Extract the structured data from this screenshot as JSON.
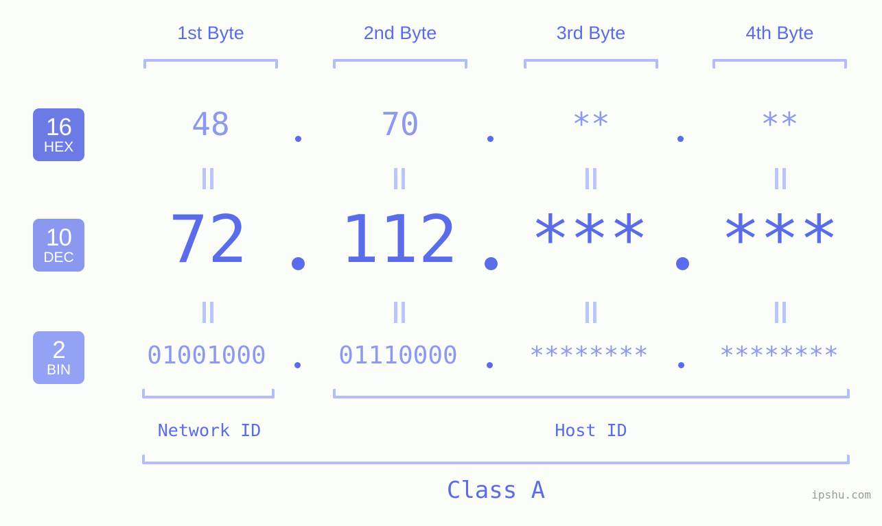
{
  "watermark": "ipshu.com",
  "columns": [
    {
      "label": "1st Byte"
    },
    {
      "label": "2nd Byte"
    },
    {
      "label": "3rd Byte"
    },
    {
      "label": "4th Byte"
    }
  ],
  "bases": [
    {
      "num": "16",
      "abbr": "HEX",
      "color": "#6c7ae6"
    },
    {
      "num": "10",
      "abbr": "DEC",
      "color": "#8b98ef"
    },
    {
      "num": "2",
      "abbr": "BIN",
      "color": "#93a2f5"
    }
  ],
  "rows": {
    "hex": {
      "values": [
        "48",
        "70",
        "**",
        "**"
      ]
    },
    "dec": {
      "values": [
        "72",
        "112",
        "***",
        "***"
      ]
    },
    "bin": {
      "values": [
        "01001000",
        "01110000",
        "********",
        "********"
      ]
    }
  },
  "separator": ".",
  "equals_mark": "||",
  "segments": {
    "network_id": "Network ID",
    "host_id": "Host ID",
    "class": "Class A"
  },
  "colors": {
    "background": "#fbfdf9",
    "accent_strong": "#5a6ce8",
    "accent_light": "#8d99ef",
    "bracket": "#b4bdfb",
    "watermark": "#9b9b9b"
  }
}
